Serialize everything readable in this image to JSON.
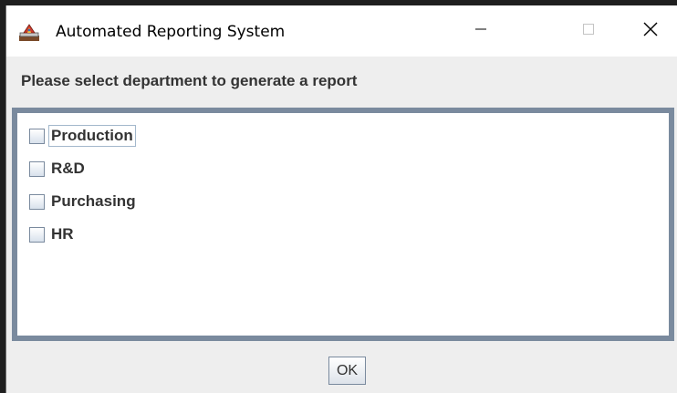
{
  "window": {
    "title": "Automated Reporting System",
    "app_icon": "java-app-icon",
    "controls": {
      "minimize_icon": "minimize-icon",
      "maximize_icon": "maximize-icon",
      "close_icon": "close-icon"
    }
  },
  "prompt": "Please select department to generate a report",
  "departments": [
    {
      "label": "Production",
      "checked": false,
      "focused": true
    },
    {
      "label": "R&D",
      "checked": false,
      "focused": false
    },
    {
      "label": "Purchasing",
      "checked": false,
      "focused": false
    },
    {
      "label": "HR",
      "checked": false,
      "focused": false
    }
  ],
  "ok_button": {
    "label": "OK"
  },
  "colors": {
    "panel_border": "#7a8a9e",
    "text": "#333333",
    "background": "#eeeeee"
  }
}
